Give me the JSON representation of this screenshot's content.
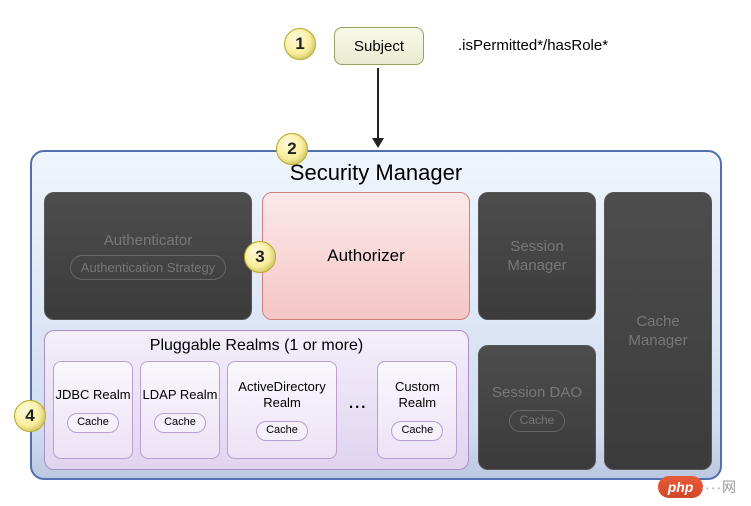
{
  "badges": {
    "one": "1",
    "two": "2",
    "three": "3",
    "four": "4"
  },
  "subject": "Subject",
  "api_call": ".isPermitted*/hasRole*",
  "sec_mgr_title": "Security Manager",
  "authenticator": {
    "title": "Authenticator",
    "strategy": "Authentication Strategy"
  },
  "authorizer": "Authorizer",
  "session_mgr": "Session Manager",
  "cache_mgr": "Cache Manager",
  "session_dao": {
    "title": "Session DAO",
    "cache": "Cache"
  },
  "realms": {
    "title": "Pluggable Realms (1 or more)",
    "ellipsis": "...",
    "items": [
      {
        "name": "JDBC Realm",
        "cache": "Cache"
      },
      {
        "name": "LDAP Realm",
        "cache": "Cache"
      },
      {
        "name": "ActiveDirectory Realm",
        "cache": "Cache"
      },
      {
        "name": "Custom Realm",
        "cache": "Cache"
      }
    ]
  },
  "watermark": {
    "brand": "php",
    "tail": "····网"
  }
}
